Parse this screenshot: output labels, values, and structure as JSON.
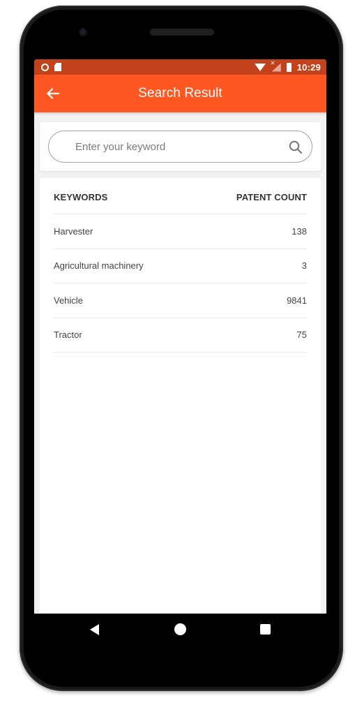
{
  "status_bar": {
    "time": "10:29",
    "icons": [
      "circle-icon",
      "sdcard-icon",
      "wifi-icon",
      "signal-icon",
      "battery-icon"
    ]
  },
  "app_bar": {
    "title": "Search Result",
    "back_icon": "arrow-left-icon",
    "color": "#ff5722"
  },
  "search": {
    "placeholder": "Enter your keyword",
    "value": "",
    "icon": "search-icon"
  },
  "results": {
    "headers": {
      "keyword": "KEYWORDS",
      "count": "PATENT COUNT"
    },
    "rows": [
      {
        "keyword": "Harvester",
        "count": "138"
      },
      {
        "keyword": "Agricultural machinery",
        "count": "3"
      },
      {
        "keyword": "Vehicle",
        "count": "9841"
      },
      {
        "keyword": "Tractor",
        "count": "75"
      }
    ]
  },
  "nav_bar": {
    "icons": [
      "back-triangle-icon",
      "home-circle-icon",
      "recents-square-icon"
    ]
  }
}
